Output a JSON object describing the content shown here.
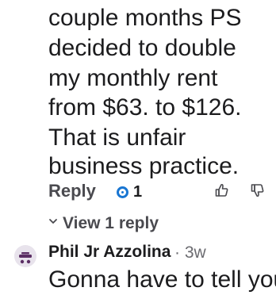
{
  "comment": {
    "lines": [
      "couple months PS",
      "decided to double",
      "my monthly rent",
      "from $63. to $126.",
      "That is unfair",
      "business practice."
    ],
    "reply_label": "Reply",
    "award_count": "1",
    "view_replies_label": "View 1 reply"
  },
  "next_comment": {
    "author": "Phil Jr Azzolina",
    "separator": "·",
    "age": "3w",
    "partial_text": "Gonna have to tell you"
  },
  "colors": {
    "text": "#1c1c1e",
    "secondary": "#4a4a4f",
    "meta": "#6b6b70",
    "award_blue": "#1976d2",
    "avatar_purple": "#5b2e64"
  },
  "icons": {
    "award": "award-icon",
    "upvote": "thumbs-up-outline-icon",
    "downvote": "thumbs-down-outline-icon",
    "expand": "chevron-down-icon",
    "avatar": "snoo-avatar-icon"
  }
}
